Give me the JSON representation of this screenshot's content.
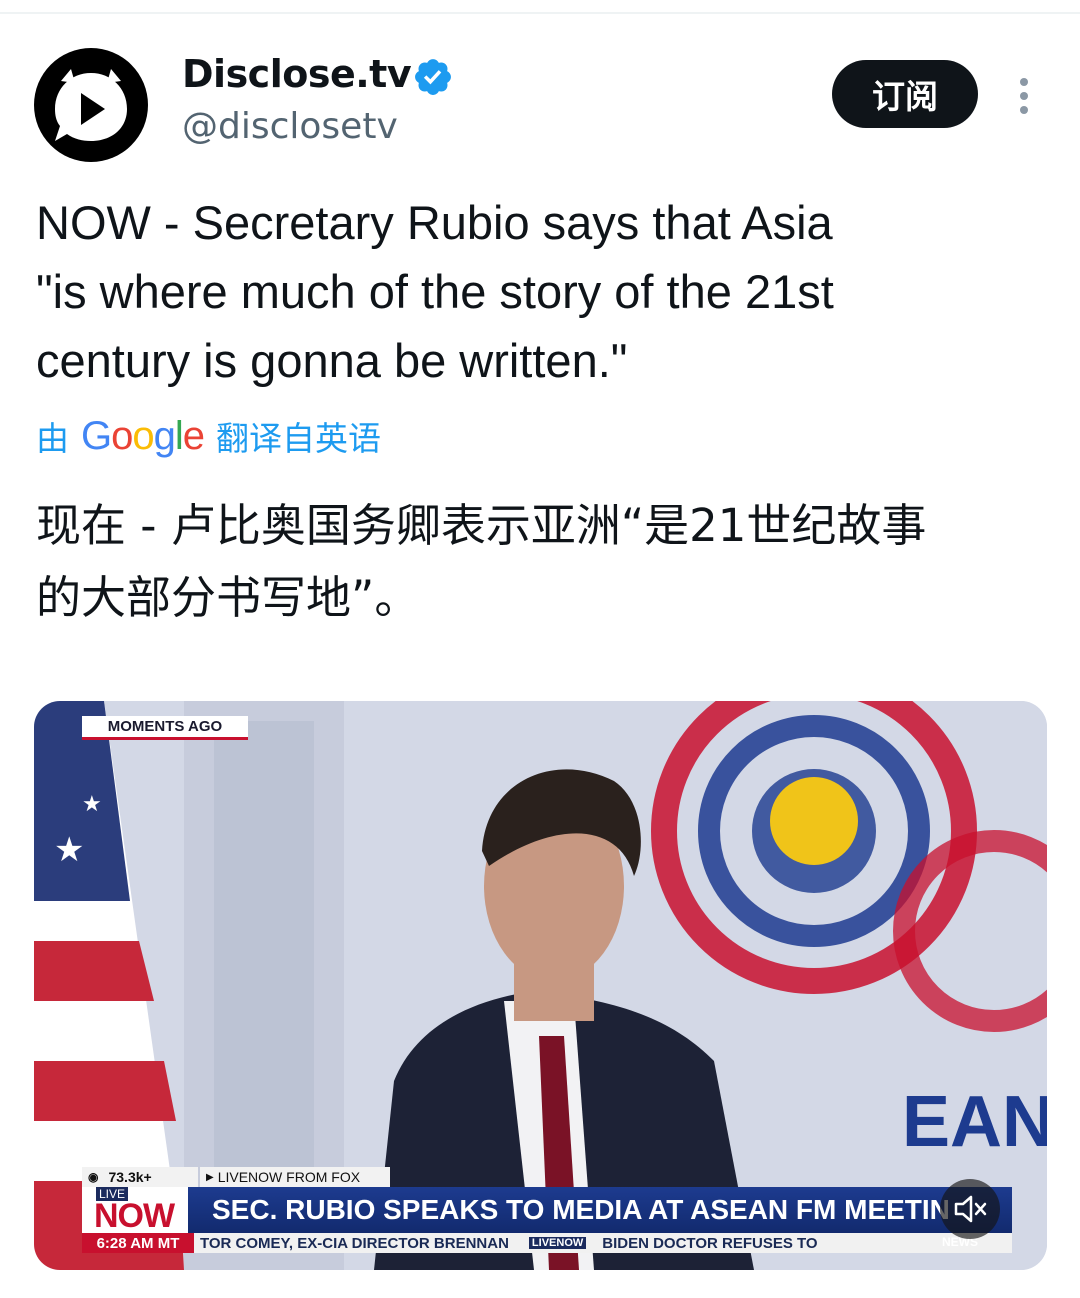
{
  "account": {
    "display_name": "Disclose.tv",
    "handle": "@disclosetv",
    "verified": true,
    "subscribe_label": "订阅",
    "avatar_icon": "play-logo-icon",
    "more_icon": "more-vertical-icon"
  },
  "tweet": {
    "text": "NOW - Secretary Rubio says that Asia\n\"is where much of the story of the 21st\ncentury is gonna be written.\"",
    "translate_prefix": "由",
    "translate_brand": "Google",
    "translate_suffix": "翻译自英语",
    "translated_text": "现在 - 卢比奥国务卿表示亚洲“是21世纪故事\n的大部分书写地”。"
  },
  "video": {
    "moments_ago": "MOMENTS AGO",
    "views": "73.3k+",
    "source": "LIVENOW FROM FOX",
    "live_small": "LIVE",
    "now_big": "NOW",
    "headline": "SEC. RUBIO SPEAKS TO MEDIA AT ASEAN FM MEETIN",
    "time": "6:28 AM MT",
    "ticker_left": "TOR COMEY, EX-CIA DIRECTOR BRENNAN",
    "ticker_mini": "LIVENOW",
    "ticker_right": "BIDEN DOCTOR REFUSES TO",
    "backdrop_text": "EAN",
    "news_tag": "NEWS",
    "mute_icon": "mute-speaker-icon"
  },
  "colors": {
    "verified": "#1d9bf0",
    "link": "#1d9bf0",
    "button_bg": "#0f1419",
    "fox_red": "#c8102e",
    "fox_blue": "#1d3b8f"
  }
}
